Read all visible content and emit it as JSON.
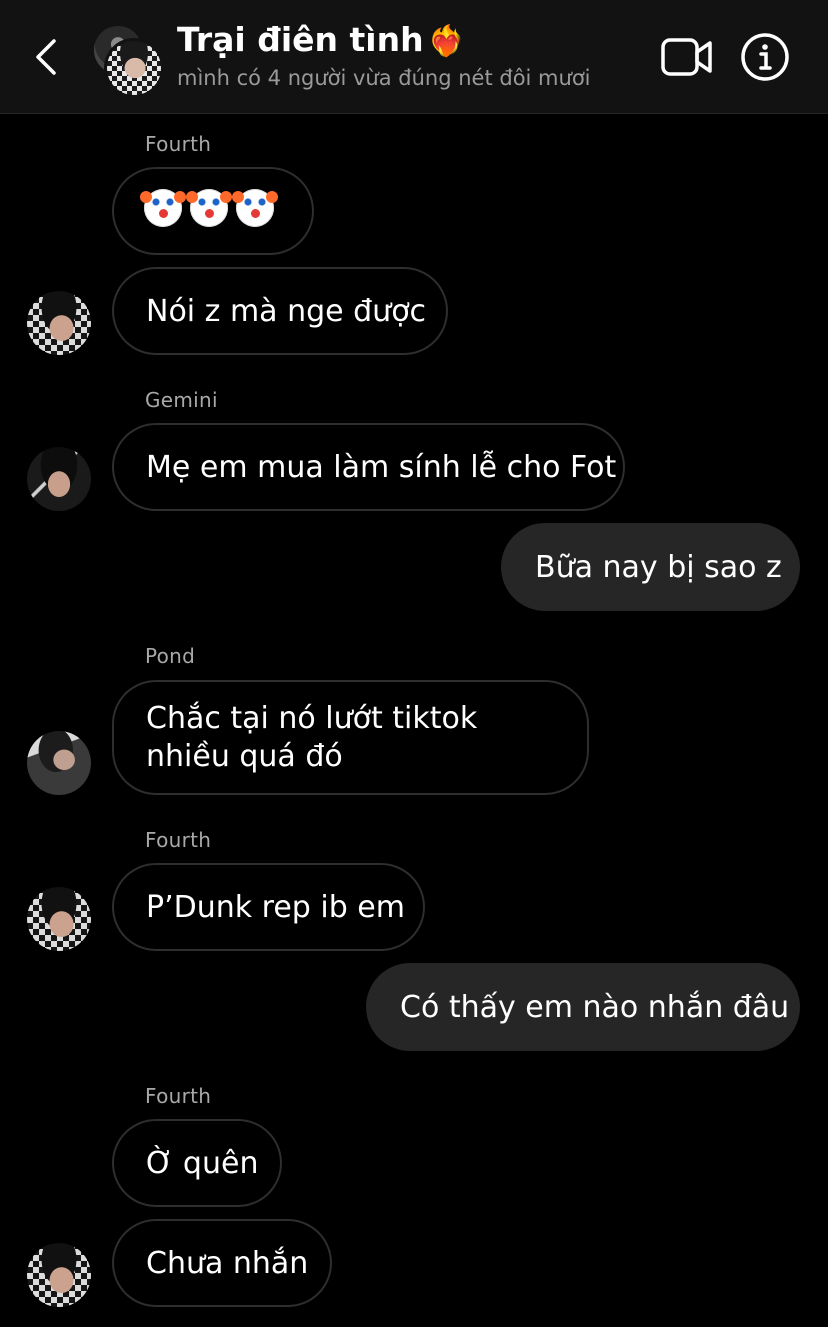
{
  "header": {
    "back_icon": "chevron-left-icon",
    "title": "Trại điên tình",
    "title_emoji": "❤️‍🔥",
    "subtitle": "mình có 4 người vừa đúng nét đôi mươi",
    "video_icon": "video-camera-icon",
    "info_icon": "info-icon"
  },
  "messages": [
    {
      "sender": "Fourth",
      "text": "🤡🤡🤡"
    },
    {
      "text": "Nói z mà nge được"
    },
    {
      "sender": "Gemini",
      "text": "Mẹ em mua làm sính lễ cho Fot"
    },
    {
      "text": "Bữa nay bị sao z",
      "outgoing": true
    },
    {
      "sender": "Pond",
      "text": "Chắc tại nó lướt tiktok nhiều quá đó"
    },
    {
      "sender": "Fourth",
      "text": "P’Dunk rep ib em"
    },
    {
      "text": "Có thấy em nào nhắn đâu",
      "outgoing": true
    },
    {
      "sender": "Fourth",
      "text": "Ờ quên"
    },
    {
      "text": "Chưa nhắn"
    }
  ],
  "colors": {
    "background": "#000000",
    "header_bg": "#121212",
    "outgoing_bubble": "#262626",
    "incoming_border": "#2e2e2e",
    "sender_name": "#a8a8a8",
    "subtitle": "#9a9a9a"
  }
}
